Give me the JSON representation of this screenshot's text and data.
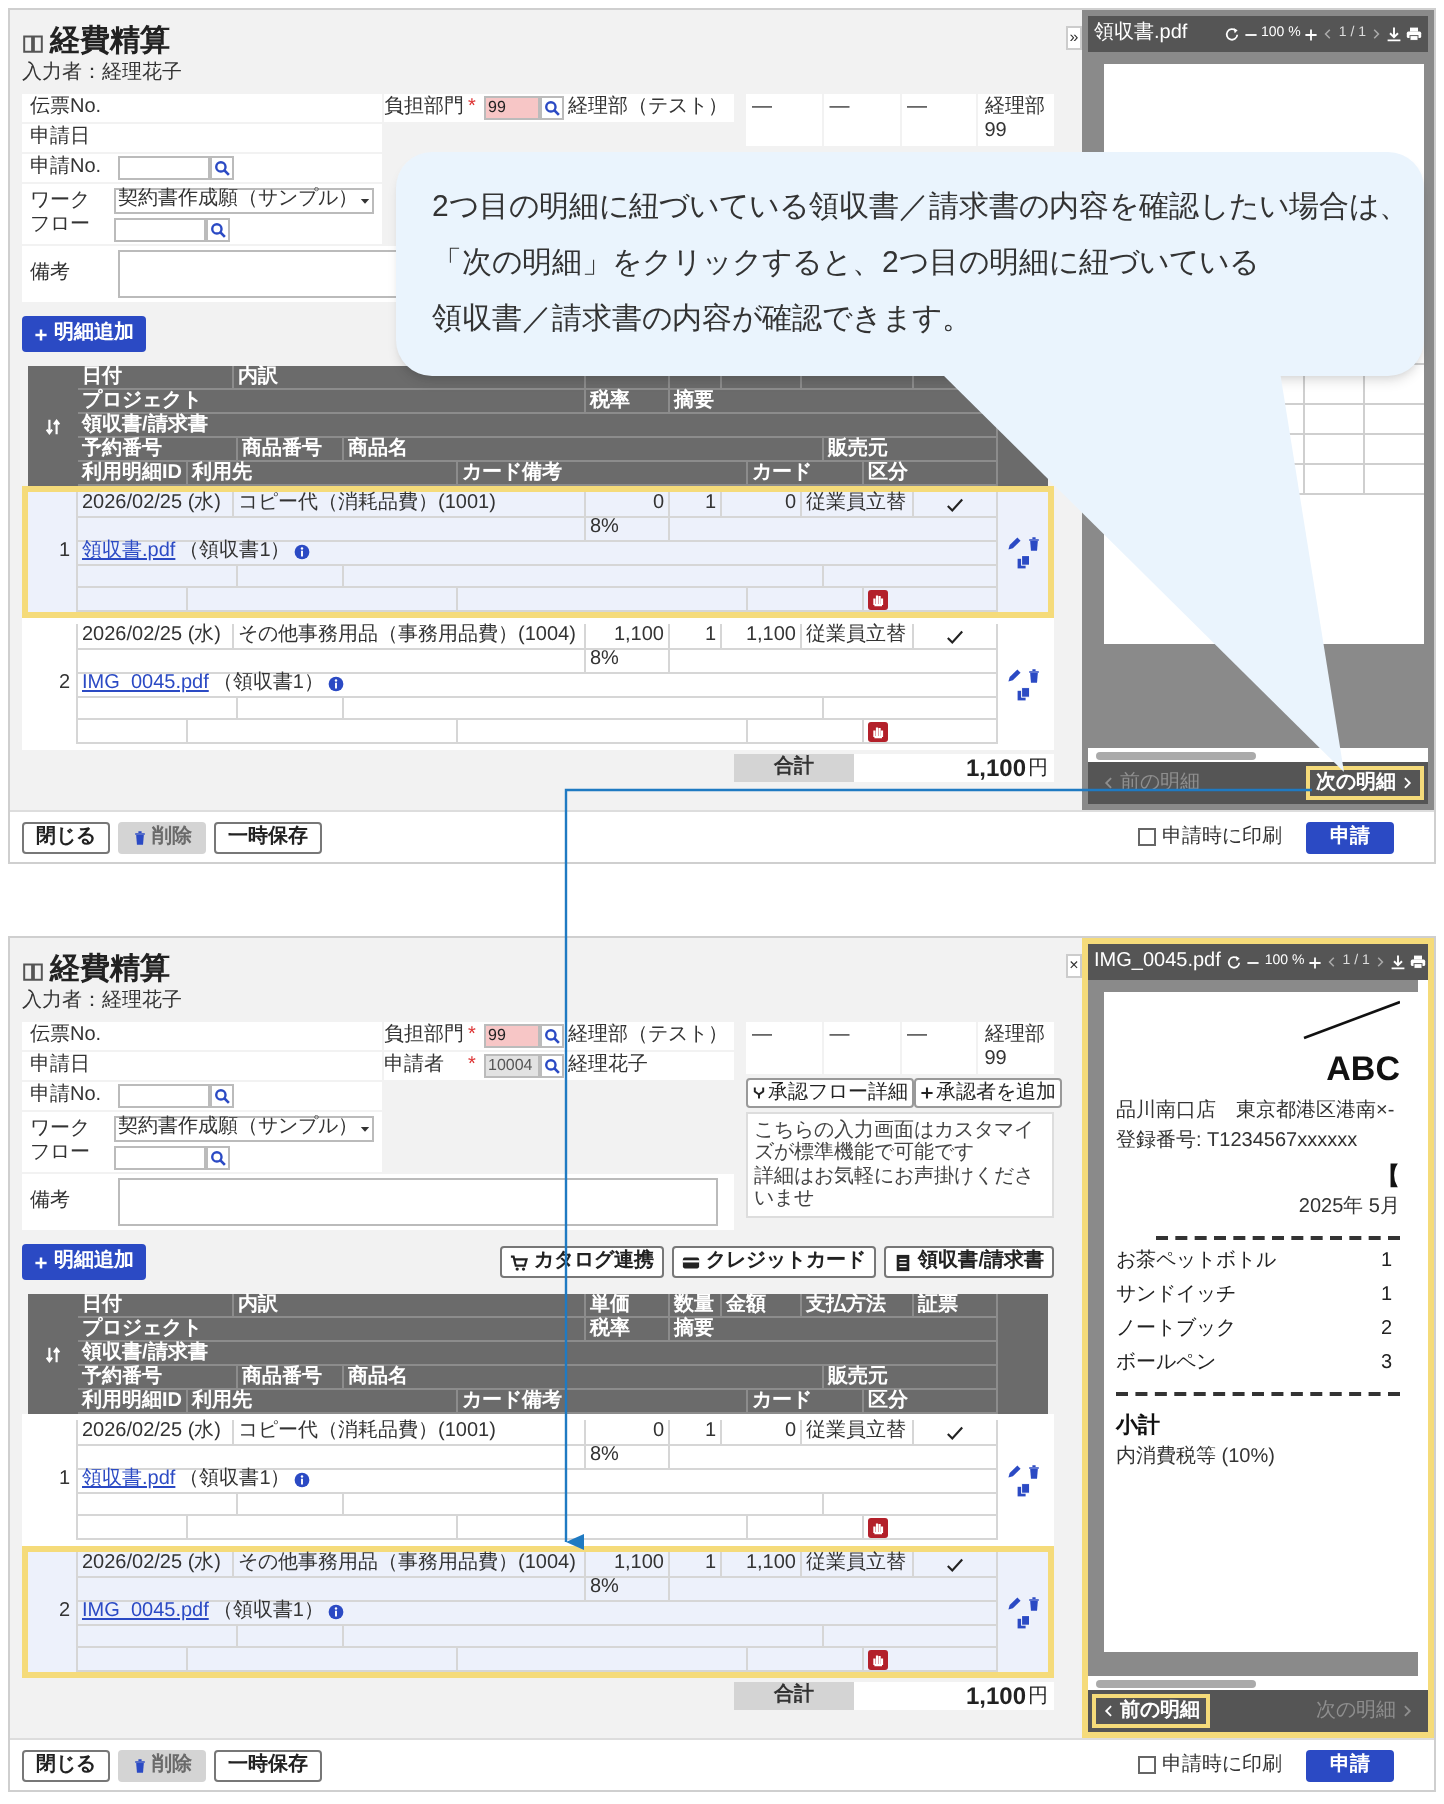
{
  "screens": [
    {
      "title": "経費精算",
      "entered_by": "入力者：経理花子",
      "form": {
        "left_rows": [
          {
            "kind": "plain",
            "label": "伝票No."
          },
          {
            "kind": "plain",
            "label": "申請日"
          },
          {
            "kind": "search",
            "label": "申請No."
          },
          {
            "kind": "workflow",
            "label": "ワークフロー",
            "value": "契約書作成願（サンプル）"
          },
          {
            "kind": "textarea",
            "label": "備考"
          }
        ],
        "right_rows": [
          {
            "label": "負担部門",
            "mark": "*",
            "value": "99",
            "error": true,
            "readonly": false,
            "name": "経理部（テスト）"
          }
        ],
        "approval": [
          [
            "—"
          ],
          [
            "—"
          ],
          [
            "—"
          ],
          [
            "経理部",
            "99"
          ]
        ]
      },
      "add_button": "明細追加",
      "table": {
        "header_rows": [
          [
            "日付",
            "内訳"
          ],
          [
            "プロジェクト",
            "税率",
            "摘要"
          ],
          [
            "領収書/請求書"
          ],
          [
            "予約番号",
            "商品番号",
            "商品名",
            "販売元"
          ],
          [
            "利用明細ID",
            "利用先",
            "カード備考",
            "カード",
            "区分"
          ]
        ],
        "rows": [
          {
            "no": "1",
            "date": "2026/02/25 (水)",
            "item": "コピー代（消耗品費）(1001)",
            "unit_price": "0",
            "qty": "1",
            "amount": "0",
            "payment": "従業員立替",
            "checked": true,
            "tax": "8%",
            "file": "領収書.pdf",
            "file_note": "（領収書1）",
            "selected": true,
            "highlighted": true
          },
          {
            "no": "2",
            "date": "2026/02/25 (水)",
            "item": "その他事務用品（事務用品費）(1004)",
            "unit_price": "1,100",
            "qty": "1",
            "amount": "1,100",
            "payment": "従業員立替",
            "checked": true,
            "tax": "8%",
            "file": "IMG_0045.pdf",
            "file_note": "（領収書1）",
            "selected": false,
            "highlighted": false
          }
        ]
      },
      "total": {
        "label": "合計",
        "value": "1,100",
        "unit": "円"
      },
      "viewer": {
        "toggle": "»",
        "filename": "領収書.pdf",
        "zoom": "100 %",
        "page": "1 / 1",
        "highlighted": false,
        "prev": {
          "label": "前の明細",
          "disabled": true,
          "highlighted": false
        },
        "next": {
          "label": "次の明細",
          "disabled": false,
          "highlighted": true
        }
      },
      "footer": {
        "buttons": [
          {
            "label": "閉じる",
            "disabled": false,
            "kind": "plain"
          },
          {
            "label": "削除",
            "disabled": true,
            "kind": "delete"
          },
          {
            "label": "一時保存",
            "disabled": false,
            "kind": "plain"
          }
        ],
        "print_option": {
          "label": "申請時に印刷",
          "checked": false
        },
        "submit": "申請"
      },
      "callout": {
        "lines": [
          "2つ目の明細に紐づいている領収書／請求書の内容を確認したい場合は、",
          "「次の明細」をクリックすると、2つ目の明細に紐づいている",
          "領収書／請求書の内容が確認できます。"
        ]
      }
    },
    {
      "title": "経費精算",
      "entered_by": "入力者：経理花子",
      "form": {
        "left_rows": [
          {
            "kind": "plain",
            "label": "伝票No."
          },
          {
            "kind": "plain",
            "label": "申請日"
          },
          {
            "kind": "search",
            "label": "申請No."
          },
          {
            "kind": "workflow",
            "label": "ワークフロー",
            "value": "契約書作成願（サンプル）"
          },
          {
            "kind": "textarea",
            "label": "備考"
          }
        ],
        "right_rows": [
          {
            "label": "負担部門",
            "mark": "*",
            "value": "99",
            "error": true,
            "readonly": false,
            "name": "経理部（テスト）"
          },
          {
            "label": "申請者",
            "mark": "*",
            "value": "10004",
            "error": false,
            "readonly": true,
            "name": "経理花子"
          }
        ],
        "approval": [
          [
            "—"
          ],
          [
            "—"
          ],
          [
            "—"
          ],
          [
            "経理部",
            "99"
          ]
        ],
        "approval_buttons": [
          {
            "label": "承認フロー詳細"
          },
          {
            "label": "承認者を追加"
          }
        ],
        "note": [
          "こちらの入力画面はカスタマイズが標準機能で可能です",
          "詳細はお気軽にお声掛けくださいませ"
        ]
      },
      "add_button": "明細追加",
      "toolbar_buttons": [
        {
          "label": "カタログ連携"
        },
        {
          "label": "クレジットカード"
        },
        {
          "label": "領収書/請求書"
        }
      ],
      "table": {
        "header_rows": [
          [
            "日付",
            "内訳",
            "単価",
            "数量",
            "金額",
            "支払方法",
            "証票"
          ],
          [
            "プロジェクト",
            "税率",
            "摘要"
          ],
          [
            "領収書/請求書"
          ],
          [
            "予約番号",
            "商品番号",
            "商品名",
            "販売元"
          ],
          [
            "利用明細ID",
            "利用先",
            "カード備考",
            "カード",
            "区分"
          ]
        ],
        "rows": [
          {
            "no": "1",
            "date": "2026/02/25 (水)",
            "item": "コピー代（消耗品費）(1001)",
            "unit_price": "0",
            "qty": "1",
            "amount": "0",
            "payment": "従業員立替",
            "checked": true,
            "tax": "8%",
            "file": "領収書.pdf",
            "file_note": "（領収書1）",
            "selected": false,
            "highlighted": false
          },
          {
            "no": "2",
            "date": "2026/02/25 (水)",
            "item": "その他事務用品（事務用品費）(1004)",
            "unit_price": "1,100",
            "qty": "1",
            "amount": "1,100",
            "payment": "従業員立替",
            "checked": true,
            "tax": "8%",
            "file": "IMG_0045.pdf",
            "file_note": "（領収書1）",
            "selected": true,
            "highlighted": true
          }
        ]
      },
      "total": {
        "label": "合計",
        "value": "1,100",
        "unit": "円"
      },
      "viewer": {
        "toggle": "×",
        "filename": "IMG_0045.pdf",
        "zoom": "100 %",
        "page": "1 / 1",
        "highlighted": true,
        "document": {
          "kind": "receipt",
          "heading": "ABC",
          "store": "品川南口店　東京都港区港南×-",
          "registration": "登録番号: T1234567xxxxxx",
          "bracket": "【",
          "date": "2025年 5月",
          "items": [
            {
              "name": "お茶ペットボトル",
              "qty": "1"
            },
            {
              "name": "サンドイッチ",
              "qty": "1"
            },
            {
              "name": "ノートブック",
              "qty": "2"
            },
            {
              "name": "ボールペン",
              "qty": "3"
            }
          ],
          "subtotal": "小計",
          "tax_note": "内消費税等 (10%)"
        },
        "prev": {
          "label": "前の明細",
          "disabled": false,
          "highlighted": true
        },
        "next": {
          "label": "次の明細",
          "disabled": true,
          "highlighted": false
        }
      },
      "footer": {
        "buttons": [
          {
            "label": "閉じる",
            "disabled": false,
            "kind": "plain"
          },
          {
            "label": "削除",
            "disabled": true,
            "kind": "delete"
          },
          {
            "label": "一時保存",
            "disabled": false,
            "kind": "plain"
          }
        ],
        "print_option": {
          "label": "申請時に印刷",
          "checked": false
        },
        "submit": "申請"
      }
    }
  ]
}
